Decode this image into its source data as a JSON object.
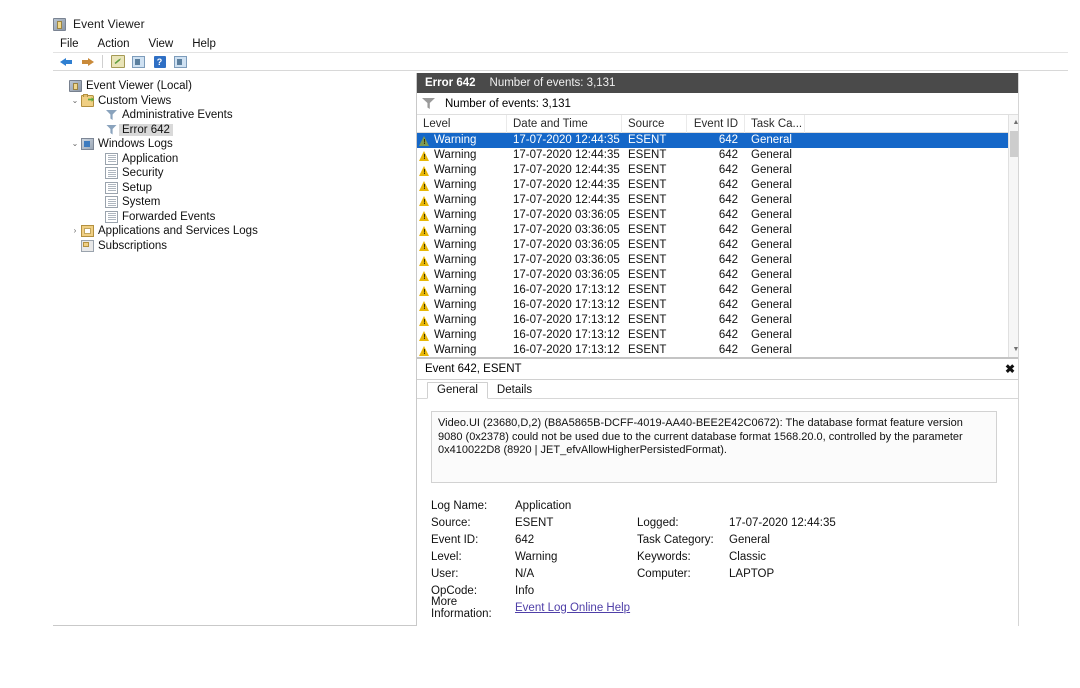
{
  "window": {
    "title": "Event Viewer",
    "icon": "event-viewer-icon"
  },
  "menu": {
    "items": [
      {
        "label": "File"
      },
      {
        "label": "Action"
      },
      {
        "label": "View"
      },
      {
        "label": "Help"
      }
    ]
  },
  "toolbar": {
    "buttons": [
      {
        "name": "back-button",
        "icon": "arrow-left-icon"
      },
      {
        "name": "forward-button",
        "icon": "arrow-right-icon"
      },
      {
        "name": "edit-button",
        "icon": "pencil-icon"
      },
      {
        "name": "show-hide-console-tree-button",
        "icon": "pane-left-icon"
      },
      {
        "name": "help-button",
        "icon": "question-mark-icon"
      },
      {
        "name": "show-hide-action-pane-button",
        "icon": "pane-right-icon"
      }
    ]
  },
  "tree": {
    "items": [
      {
        "label": "Event Viewer (Local)",
        "level": 0,
        "icon": "console-root-icon",
        "twisty": "",
        "selected": false
      },
      {
        "label": "Custom Views",
        "level": 1,
        "icon": "custom-views-folder-icon",
        "twisty": "⌄",
        "selected": false
      },
      {
        "label": "Administrative Events",
        "level": 2,
        "icon": "funnel-icon",
        "twisty": "",
        "selected": false
      },
      {
        "label": "Error 642",
        "level": 2,
        "icon": "funnel-icon",
        "twisty": "",
        "selected": true
      },
      {
        "label": "Windows Logs",
        "level": 1,
        "icon": "windows-logs-icon",
        "twisty": "⌄",
        "selected": false
      },
      {
        "label": "Application",
        "level": 2,
        "icon": "log-blue-icon",
        "twisty": "",
        "selected": false
      },
      {
        "label": "Security",
        "level": 2,
        "icon": "log-blue-icon",
        "twisty": "",
        "selected": false
      },
      {
        "label": "Setup",
        "level": 2,
        "icon": "log-plain-icon",
        "twisty": "",
        "selected": false
      },
      {
        "label": "System",
        "level": 2,
        "icon": "log-blue-icon",
        "twisty": "",
        "selected": false
      },
      {
        "label": "Forwarded Events",
        "level": 2,
        "icon": "log-plain-icon",
        "twisty": "",
        "selected": false
      },
      {
        "label": "Applications and Services Logs",
        "level": 1,
        "icon": "apps-services-folder-icon",
        "twisty": "›",
        "selected": false
      },
      {
        "label": "Subscriptions",
        "level": 1,
        "icon": "subscriptions-icon",
        "twisty": "",
        "selected": false
      }
    ]
  },
  "pane": {
    "header_title": "Error 642",
    "header_subtitle": "Number of events: 3,131",
    "filter_text": "Number of events: 3,131"
  },
  "list": {
    "columns": [
      {
        "label": "Level"
      },
      {
        "label": "Date and Time"
      },
      {
        "label": "Source"
      },
      {
        "label": "Event ID"
      },
      {
        "label": "Task Ca..."
      }
    ],
    "rows": [
      {
        "level": "Warning",
        "date": "17-07-2020 12:44:35",
        "source": "ESENT",
        "event_id": "642",
        "task": "General",
        "selected": true
      },
      {
        "level": "Warning",
        "date": "17-07-2020 12:44:35",
        "source": "ESENT",
        "event_id": "642",
        "task": "General",
        "selected": false
      },
      {
        "level": "Warning",
        "date": "17-07-2020 12:44:35",
        "source": "ESENT",
        "event_id": "642",
        "task": "General",
        "selected": false
      },
      {
        "level": "Warning",
        "date": "17-07-2020 12:44:35",
        "source": "ESENT",
        "event_id": "642",
        "task": "General",
        "selected": false
      },
      {
        "level": "Warning",
        "date": "17-07-2020 12:44:35",
        "source": "ESENT",
        "event_id": "642",
        "task": "General",
        "selected": false
      },
      {
        "level": "Warning",
        "date": "17-07-2020 03:36:05",
        "source": "ESENT",
        "event_id": "642",
        "task": "General",
        "selected": false
      },
      {
        "level": "Warning",
        "date": "17-07-2020 03:36:05",
        "source": "ESENT",
        "event_id": "642",
        "task": "General",
        "selected": false
      },
      {
        "level": "Warning",
        "date": "17-07-2020 03:36:05",
        "source": "ESENT",
        "event_id": "642",
        "task": "General",
        "selected": false
      },
      {
        "level": "Warning",
        "date": "17-07-2020 03:36:05",
        "source": "ESENT",
        "event_id": "642",
        "task": "General",
        "selected": false
      },
      {
        "level": "Warning",
        "date": "17-07-2020 03:36:05",
        "source": "ESENT",
        "event_id": "642",
        "task": "General",
        "selected": false
      },
      {
        "level": "Warning",
        "date": "16-07-2020 17:13:12",
        "source": "ESENT",
        "event_id": "642",
        "task": "General",
        "selected": false
      },
      {
        "level": "Warning",
        "date": "16-07-2020 17:13:12",
        "source": "ESENT",
        "event_id": "642",
        "task": "General",
        "selected": false
      },
      {
        "level": "Warning",
        "date": "16-07-2020 17:13:12",
        "source": "ESENT",
        "event_id": "642",
        "task": "General",
        "selected": false
      },
      {
        "level": "Warning",
        "date": "16-07-2020 17:13:12",
        "source": "ESENT",
        "event_id": "642",
        "task": "General",
        "selected": false
      },
      {
        "level": "Warning",
        "date": "16-07-2020 17:13:12",
        "source": "ESENT",
        "event_id": "642",
        "task": "General",
        "selected": false
      }
    ]
  },
  "detail": {
    "title": "Event 642, ESENT",
    "close_label": "✖",
    "tabs": [
      {
        "label": "General",
        "active": true
      },
      {
        "label": "Details",
        "active": false
      }
    ],
    "description": "Video.UI (23680,D,2) (B8A5865B-DCFF-4019-AA40-BEE2E42C0672): The database format feature version 9080 (0x2378) could not be used due to the current database format 1568.20.0, controlled by the parameter 0x410022D8 (8920 | JET_efvAllowHigherPersistedFormat).",
    "fields": {
      "log_name_label": "Log Name:",
      "log_name_value": "Application",
      "source_label": "Source:",
      "source_value": "ESENT",
      "logged_label": "Logged:",
      "logged_value": "17-07-2020 12:44:35",
      "event_id_label": "Event ID:",
      "event_id_value": "642",
      "task_category_label": "Task Category:",
      "task_category_value": "General",
      "level_label": "Level:",
      "level_value": "Warning",
      "keywords_label": "Keywords:",
      "keywords_value": "Classic",
      "user_label": "User:",
      "user_value": "N/A",
      "computer_label": "Computer:",
      "computer_value": "LAPTOP",
      "opcode_label": "OpCode:",
      "opcode_value": "Info",
      "more_info_label": "More Information:",
      "more_info_link": "Event Log Online Help"
    }
  },
  "colors": {
    "selection_blue": "#1567c8",
    "header_dark": "#4a4a4a",
    "warning_yellow": "#e8b706",
    "link_purple": "#4f3fa8"
  }
}
